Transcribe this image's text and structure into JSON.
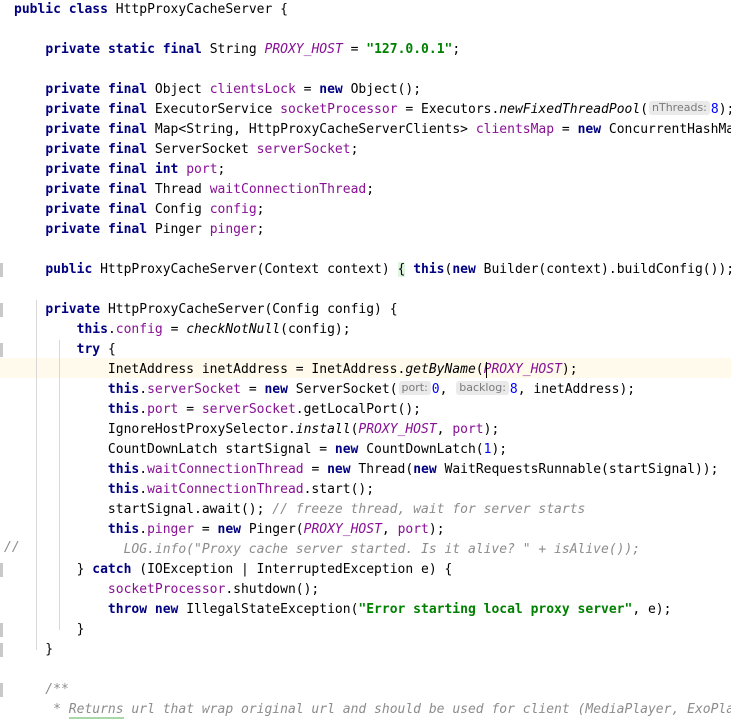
{
  "editor": {
    "language": "Java",
    "class_name": "HttpProxyCacheServer",
    "colors": {
      "background": "#ffffff",
      "keyword": "#000080",
      "string": "#008000",
      "number": "#0000ff",
      "field": "#871094",
      "comment": "#8c8c8c",
      "caret_line_highlight": "#fffaec",
      "hint_background": "#eaeaea",
      "hint_text": "#7a7a7a",
      "indent_guide": "#d8d8d8",
      "brace_match_highlight": "#e0f5e0"
    },
    "caret_line_index": 17
  },
  "code_lines": [
    {
      "i": 0,
      "indent": 0,
      "text": "public class HttpProxyCacheServer {"
    },
    {
      "i": 1,
      "indent": 0,
      "text": ""
    },
    {
      "i": 2,
      "indent": 1,
      "text": "private static final String PROXY_HOST = \"127.0.0.1\";"
    },
    {
      "i": 3,
      "indent": 0,
      "text": ""
    },
    {
      "i": 4,
      "indent": 1,
      "text": "private final Object clientsLock = new Object();"
    },
    {
      "i": 5,
      "indent": 1,
      "text": "private final ExecutorService socketProcessor = Executors.newFixedThreadPool( nThreads: 8);"
    },
    {
      "i": 6,
      "indent": 1,
      "text": "private final Map<String, HttpProxyCacheServerClients> clientsMap = new ConcurrentHashMap<>();"
    },
    {
      "i": 7,
      "indent": 1,
      "text": "private final ServerSocket serverSocket;"
    },
    {
      "i": 8,
      "indent": 1,
      "text": "private final int port;"
    },
    {
      "i": 9,
      "indent": 1,
      "text": "private final Thread waitConnectionThread;"
    },
    {
      "i": 10,
      "indent": 1,
      "text": "private final Config config;"
    },
    {
      "i": 11,
      "indent": 1,
      "text": "private final Pinger pinger;"
    },
    {
      "i": 12,
      "indent": 0,
      "text": ""
    },
    {
      "i": 13,
      "indent": 1,
      "text": "public HttpProxyCacheServer(Context context) { this(new Builder(context).buildConfig()); }"
    },
    {
      "i": 14,
      "indent": 0,
      "text": ""
    },
    {
      "i": 15,
      "indent": 1,
      "text": "private HttpProxyCacheServer(Config config) {"
    },
    {
      "i": 16,
      "indent": 2,
      "text": "this.config = checkNotNull(config);"
    },
    {
      "i": 17,
      "indent": 2,
      "text": "try {"
    },
    {
      "i": 18,
      "indent": 3,
      "text": "InetAddress inetAddress = InetAddress.getByName(PROXY_HOST);"
    },
    {
      "i": 19,
      "indent": 3,
      "text": "this.serverSocket = new ServerSocket( port: 0,  backlog: 8, inetAddress);"
    },
    {
      "i": 20,
      "indent": 3,
      "text": "this.port = serverSocket.getLocalPort();"
    },
    {
      "i": 21,
      "indent": 3,
      "text": "IgnoreHostProxySelector.install(PROXY_HOST, port);"
    },
    {
      "i": 22,
      "indent": 3,
      "text": "CountDownLatch startSignal = new CountDownLatch(1);"
    },
    {
      "i": 23,
      "indent": 3,
      "text": "this.waitConnectionThread = new Thread(new WaitRequestsRunnable(startSignal));"
    },
    {
      "i": 24,
      "indent": 3,
      "text": "this.waitConnectionThread.start();"
    },
    {
      "i": 25,
      "indent": 3,
      "text": "startSignal.await(); // freeze thread, wait for server starts"
    },
    {
      "i": 26,
      "indent": 3,
      "text": "this.pinger = new Pinger(PROXY_HOST, port);"
    },
    {
      "i": 27,
      "indent": 3,
      "text": "LOG.info(\"Proxy cache server started. Is it alive? \" + isAlive());"
    },
    {
      "i": 28,
      "indent": 2,
      "text": "} catch (IOException | InterruptedException e) {"
    },
    {
      "i": 29,
      "indent": 3,
      "text": "socketProcessor.shutdown();"
    },
    {
      "i": 30,
      "indent": 3,
      "text": "throw new IllegalStateException(\"Error starting local proxy server\", e);"
    },
    {
      "i": 31,
      "indent": 2,
      "text": "}"
    },
    {
      "i": 32,
      "indent": 1,
      "text": "}"
    },
    {
      "i": 33,
      "indent": 0,
      "text": ""
    },
    {
      "i": 34,
      "indent": 1,
      "text": "/**"
    },
    {
      "i": 35,
      "indent": 1,
      "text": " * Returns url that wrap original url and should be used for client (MediaPlayer, ExoPlayer, etc)."
    }
  ],
  "parameter_hints": [
    {
      "label": "nThreads:",
      "value": "8",
      "line": 5
    },
    {
      "label": "port:",
      "value": "0",
      "line": 19
    },
    {
      "label": "backlog:",
      "value": "8",
      "line": 19
    }
  ],
  "gutter": {
    "comment_marker": "//",
    "comment_marker_line": 27
  },
  "string_literals": [
    "\"127.0.0.1\"",
    "\"Error starting local proxy server\"",
    "\"Proxy cache server started. Is it alive? \""
  ],
  "identifiers": {
    "constants": [
      "PROXY_HOST"
    ],
    "fields": [
      "clientsLock",
      "socketProcessor",
      "clientsMap",
      "serverSocket",
      "port",
      "waitConnectionThread",
      "config",
      "pinger"
    ],
    "types": [
      "Object",
      "ExecutorService",
      "Executors",
      "Map",
      "String",
      "HttpProxyCacheServerClients",
      "ConcurrentHashMap",
      "ServerSocket",
      "int",
      "Thread",
      "Config",
      "Pinger",
      "Context",
      "Builder",
      "InetAddress",
      "IgnoreHostProxySelector",
      "CountDownLatch",
      "WaitRequestsRunnable",
      "IOException",
      "InterruptedException",
      "IllegalStateException"
    ],
    "methods": [
      "newFixedThreadPool",
      "buildConfig",
      "checkNotNull",
      "getByName",
      "getLocalPort",
      "install",
      "start",
      "await",
      "info",
      "isAlive",
      "shutdown"
    ]
  },
  "comments": [
    "// freeze thread, wait for server starts",
    "/**",
    " * Returns url that wrap original url and should be used for client (MediaPlayer, ExoPlayer, etc)."
  ]
}
